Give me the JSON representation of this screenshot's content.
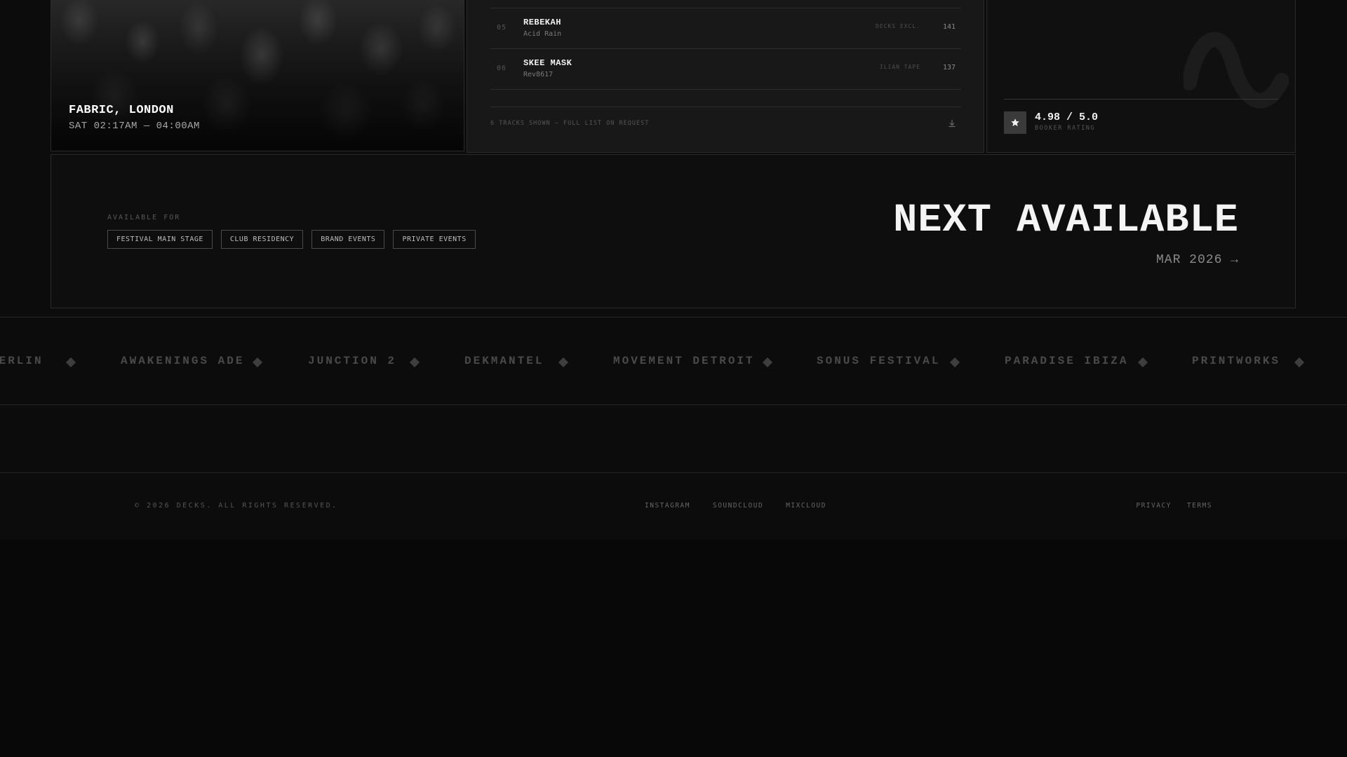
{
  "gig": {
    "venue": "FABRIC, LONDON",
    "time": "SAT 02:17AM — 04:00AM"
  },
  "tracklist": {
    "tracks": [
      {
        "num": "05",
        "artist": "REBEKAH",
        "title": "Acid Rain",
        "label": "DECKS EXCL.",
        "bpm": "141"
      },
      {
        "num": "06",
        "artist": "SKEE MASK",
        "title": "Rev8617",
        "label": "ILIAN TAPE",
        "bpm": "137"
      }
    ],
    "footer_note": "6 TRACKS SHOWN — FULL LIST ON REQUEST",
    "download_icon": "download-icon"
  },
  "rating": {
    "value": "4.98 / 5.0",
    "caption": "BOOKER RATING",
    "icon": "star-icon"
  },
  "availability": {
    "label": "AVAILABLE FOR",
    "tags": [
      "FESTIVAL MAIN STAGE",
      "CLUB RESIDENCY",
      "BRAND EVENTS",
      "PRIVATE EVENTS"
    ],
    "next_title": "NEXT AVAILABLE",
    "next_date": "MAR 2026 →"
  },
  "marquee": {
    "items": [
      "BERLIN",
      "AWAKENINGS ADE",
      "JUNCTION 2",
      "DEKMANTEL",
      "MOVEMENT DETROIT",
      "SONUS FESTIVAL",
      "PARADISE IBIZA",
      "PRINTWORKS"
    ]
  },
  "footer": {
    "copyright": "© 2026 DECKS. ALL RIGHTS RESERVED.",
    "social": [
      "INSTAGRAM",
      "SOUNDCLOUD",
      "MIXCLOUD"
    ],
    "legal": [
      "PRIVACY",
      "TERMS"
    ]
  },
  "colors": {
    "background": "#080808",
    "panel": "#181818",
    "text": "#f2f2f2",
    "muted": "#555555"
  }
}
